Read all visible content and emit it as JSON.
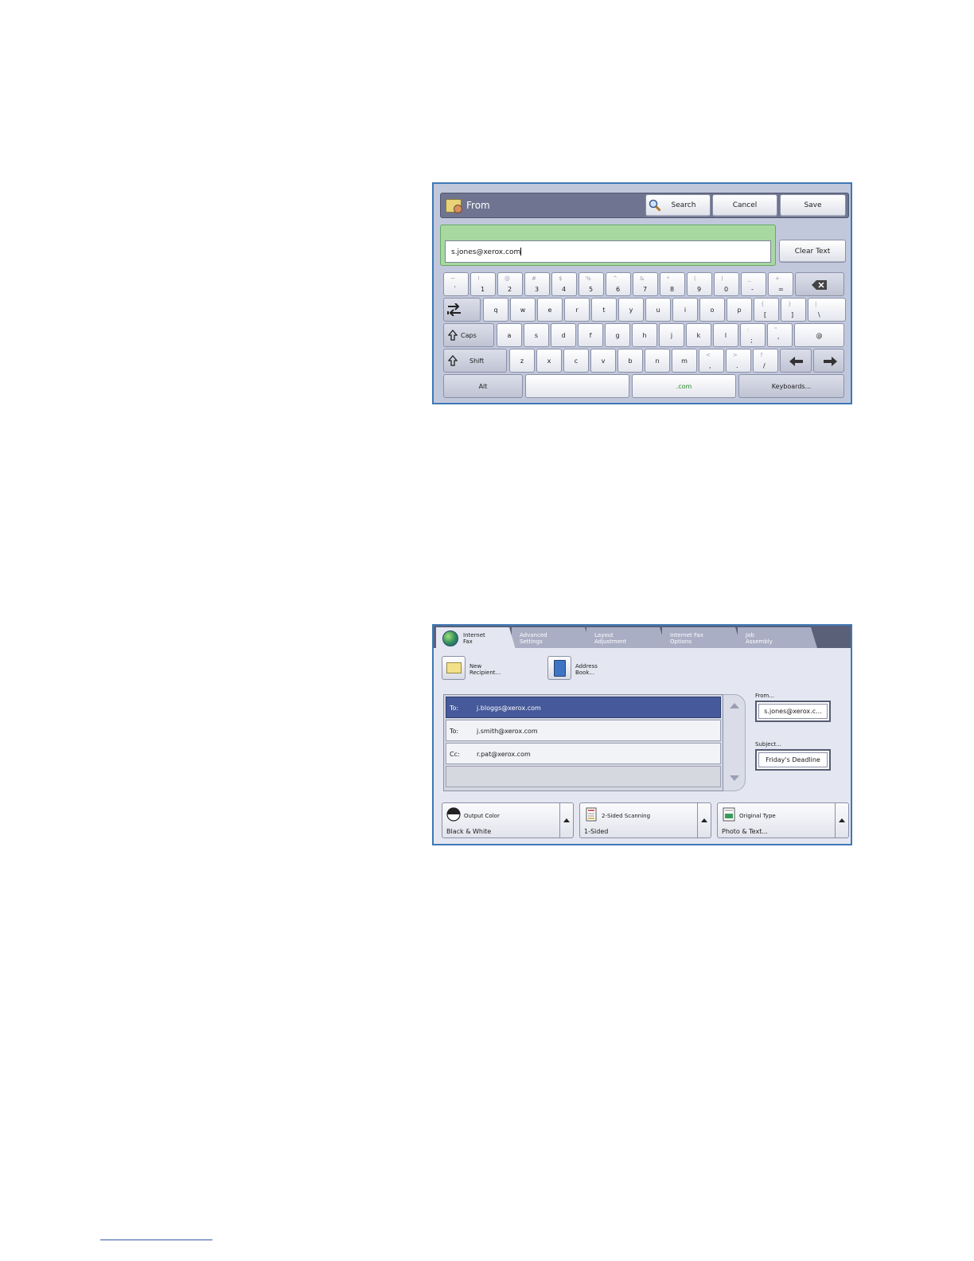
{
  "keyboard_screen": {
    "title": "From",
    "search_label": "Search",
    "cancel_label": "Cancel",
    "save_label": "Save",
    "input_value": "s.jones@xerox.com",
    "clear_text_label": "Clear Text",
    "row1": [
      {
        "sec": "~",
        "pri": "`"
      },
      {
        "sec": "!",
        "pri": "1"
      },
      {
        "sec": "@",
        "pri": "2"
      },
      {
        "sec": "#",
        "pri": "3"
      },
      {
        "sec": "$",
        "pri": "4"
      },
      {
        "sec": "%",
        "pri": "5"
      },
      {
        "sec": "^",
        "pri": "6"
      },
      {
        "sec": "&",
        "pri": "7"
      },
      {
        "sec": "*",
        "pri": "8"
      },
      {
        "sec": "(",
        "pri": "9"
      },
      {
        "sec": ")",
        "pri": "0"
      },
      {
        "sec": "_",
        "pri": "-"
      },
      {
        "sec": "+",
        "pri": "="
      }
    ],
    "row2": [
      "q",
      "w",
      "e",
      "r",
      "t",
      "y",
      "u",
      "i",
      "o",
      "p"
    ],
    "row2_brackets": [
      {
        "sec": "{",
        "pri": "["
      },
      {
        "sec": "}",
        "pri": "]"
      },
      {
        "sec": "|",
        "pri": "\\"
      }
    ],
    "caps_label": "Caps",
    "row3": [
      "a",
      "s",
      "d",
      "f",
      "g",
      "h",
      "j",
      "k",
      "l"
    ],
    "row3_punct": [
      {
        "sec": ":",
        "pri": ";"
      },
      {
        "sec": "\"",
        "pri": "'"
      }
    ],
    "at_key": "@",
    "shift_label": "Shift",
    "row4": [
      "z",
      "x",
      "c",
      "v",
      "b",
      "n",
      "m"
    ],
    "row4_punct": [
      {
        "sec": "<",
        "pri": ","
      },
      {
        "sec": ">",
        "pri": "."
      },
      {
        "sec": "?",
        "pri": "/"
      }
    ],
    "alt_label": "Alt",
    "com_label": ".com",
    "keyboards_label": "Keyboards..."
  },
  "fax_screen": {
    "tabs": [
      {
        "line1": "Internet",
        "line2": "Fax"
      },
      {
        "line1": "Advanced",
        "line2": "Settings"
      },
      {
        "line1": "Layout",
        "line2": "Adjustment"
      },
      {
        "line1": "Internet Fax",
        "line2": "Options"
      },
      {
        "line1": "Job",
        "line2": "Assembly"
      }
    ],
    "new_recipient": {
      "line1": "New",
      "line2": "Recipient..."
    },
    "address_book": {
      "line1": "Address",
      "line2": "Book..."
    },
    "recipients": [
      {
        "type": "To:",
        "email": "j.bloggs@xerox.com"
      },
      {
        "type": "To:",
        "email": "j.smith@xerox.com"
      },
      {
        "type": "Cc:",
        "email": "r.pat@xerox.com"
      }
    ],
    "from_label": "From...",
    "from_value": "s.jones@xerox.c...",
    "subject_label": "Subject...",
    "subject_value": "Friday's Deadline",
    "options": [
      {
        "title": "Output Color",
        "value": "Black & White"
      },
      {
        "title": "2-Sided Scanning",
        "value": "1-Sided"
      },
      {
        "title": "Original Type",
        "value": "Photo & Text..."
      }
    ]
  }
}
